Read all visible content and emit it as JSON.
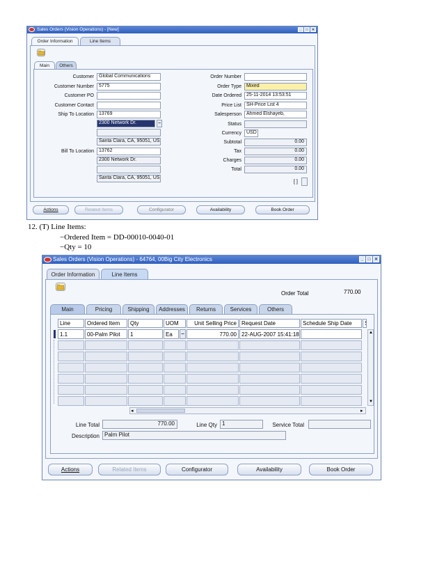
{
  "top": {
    "title": "Sales Orders (Vision Operations) - [New]",
    "tabs": [
      "Order Information",
      "Line Items"
    ],
    "subtabs": [
      "Main",
      "Others"
    ],
    "left_labels": [
      "Customer",
      "Customer Number",
      "Customer PO",
      "Customer Contact",
      "Ship To Location",
      "Bill To Location"
    ],
    "left_values": {
      "customer": "Global Communications",
      "customer_number": "5775",
      "customer_po": "",
      "customer_contact": "",
      "ship_to": "13769",
      "ship_addr1": "2300 Network Dr.",
      "ship_addr2": "",
      "ship_addr3": "Santa Clara, CA, 95051, US",
      "bill_to": "13762",
      "bill_addr1": "2300 Network Dr.",
      "bill_addr2": "",
      "bill_addr3": "Santa Clara, CA, 95051, US"
    },
    "right_labels": [
      "Order Number",
      "Order Type",
      "Date Ordered",
      "Price List",
      "Salesperson",
      "Status",
      "Currency",
      "Subtotal",
      "Tax",
      "Charges",
      "Total"
    ],
    "right_values": {
      "order_number": "",
      "order_type": "Mixed",
      "date_ordered": "25-11-2014 13:53:51",
      "price_list": "SH-Price List 4",
      "salesperson": "Ahmed Elshayeb,",
      "status": "",
      "currency": "USD",
      "subtotal": "0.00",
      "tax": "0.00",
      "charges": "0.00",
      "total": "0.00"
    },
    "bracket": "[ ]",
    "buttons": [
      "Actions",
      "Related Items",
      "Configurator",
      "Availability",
      "Book Order"
    ]
  },
  "doc": {
    "step": "12.  (T) Line Items:",
    "bullet1": "−Ordered Item = DD-00010-0040-01",
    "bullet2": "−Qty = 10"
  },
  "bottom": {
    "title": "Sales Orders (Vision Operations) - 64764, 00Big City Electronics",
    "tabs": [
      "Order Information",
      "Line Items"
    ],
    "order_total_label": "Order Total",
    "order_total_value": "770.00",
    "subtabs": [
      "Main",
      "Pricing",
      "Shipping",
      "Addresses",
      "Returns",
      "Services",
      "Others"
    ],
    "columns": [
      "Line",
      "Ordered Item",
      "Qty",
      "UOM",
      "Unit Selling Price",
      "Request Date",
      "Schedule Ship Date",
      "S"
    ],
    "rows": [
      [
        "1.1",
        "00-Palm Pilot",
        "1",
        "Ea",
        "770.00",
        "22-AUG-2007 15:41:18",
        ""
      ]
    ],
    "line_total_label": "Line Total",
    "line_total_value": "770.00",
    "line_qty_label": "Line Qty",
    "line_qty_value": "1",
    "service_total_label": "Service Total",
    "service_total_value": "",
    "description_label": "Description",
    "description_value": "Palm Pilot",
    "buttons": [
      "Actions",
      "Related Items",
      "Configurator",
      "Availability",
      "Book Order"
    ]
  }
}
